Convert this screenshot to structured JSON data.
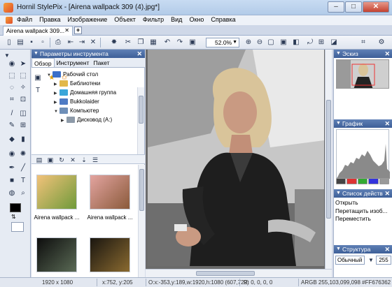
{
  "window": {
    "title": "Hornil StylePix - [Airena wallpack 309 (4).jpg*]",
    "minimize_label": "–",
    "maximize_label": "□",
    "close_label": "✕"
  },
  "menubar": {
    "items": [
      "Файл",
      "Правка",
      "Изображение",
      "Объект",
      "Фильтр",
      "Вид",
      "Окно",
      "Справка"
    ]
  },
  "doc_tab": {
    "label": "Airena wallpack 309...",
    "close": "✕",
    "new_tab": "+"
  },
  "toolbar": {
    "zoom_value": "52.0%"
  },
  "tool_params_panel": {
    "title": "Параметры инструмента",
    "tabs": [
      "Обзор",
      "Инструмент",
      "Пакет"
    ],
    "tree": [
      {
        "label": "Рабочий стол",
        "level": 0,
        "toggle": "▼",
        "color": "#3a6fc9"
      },
      {
        "label": "Библиотеки",
        "level": 1,
        "toggle": "▶",
        "color": "#e2b84a"
      },
      {
        "label": "Домашняя группа",
        "level": 1,
        "toggle": "▶",
        "color": "#3aa6d9"
      },
      {
        "label": "Bukkolaider",
        "level": 1,
        "toggle": "▶",
        "color": "#4e7bc4"
      },
      {
        "label": "Компьютер",
        "level": 1,
        "toggle": "▼",
        "color": "#6e8fb8"
      },
      {
        "label": "Дисковод (A:)",
        "level": 2,
        "toggle": "▶",
        "color": "#8d9aa8"
      }
    ]
  },
  "thumbnails": [
    {
      "caption": "Airena wallpack ...",
      "colors": [
        "#f2c27a",
        "#6f9a3a"
      ]
    },
    {
      "caption": "Airena wallpack ...",
      "colors": [
        "#e3a4a0",
        "#8a5a3a"
      ]
    },
    {
      "caption": "",
      "colors": [
        "#0d0d0d",
        "#5a6a55"
      ]
    },
    {
      "caption": "",
      "colors": [
        "#1a1610",
        "#8a6a30"
      ]
    }
  ],
  "right_panels": {
    "preview_title": "Эскиз",
    "histogram_title": "График",
    "actions_title": "Список действ",
    "actions": [
      "Открыть",
      "Перетащить изоб...",
      "Переместить"
    ],
    "structure_title": "Структура",
    "structure_mode": "Обычный",
    "structure_value": "255"
  },
  "status": {
    "size": "1920 x 1080",
    "cursor": "x:752, y:205",
    "selection": "O:x:-353,y:189,w:1920,h:1080 (607,729)",
    "rgb": "R: 0, 0, 0, 0",
    "argb": "ARGB 255,103,099,098 #FF676362"
  }
}
